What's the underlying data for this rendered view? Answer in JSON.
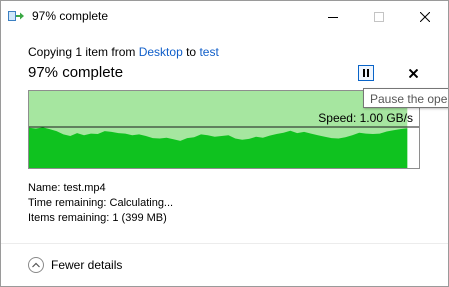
{
  "window": {
    "title": "97% complete"
  },
  "copy": {
    "prefix": "Copying 1 item from",
    "source": "Desktop",
    "mid": "to",
    "destination": "test",
    "status": "97% complete"
  },
  "controls": {
    "pause_tooltip": "Pause the operation"
  },
  "graph": {
    "speed_label": "Speed: 1.00 GB/s",
    "progress": 0.97,
    "fill_color": "#a6e6a0",
    "area_color": "#0fc21f",
    "line_color": "#1b1b1b",
    "speed_samples": [
      0.98,
      0.96,
      0.99,
      0.95,
      0.9,
      0.82,
      0.78,
      0.85,
      0.8,
      0.84,
      0.83,
      0.9,
      0.88,
      0.85,
      0.84,
      0.8,
      0.82,
      0.78,
      0.73,
      0.72,
      0.74,
      0.7,
      0.66,
      0.73,
      0.75,
      0.82,
      0.8,
      0.76,
      0.78,
      0.8,
      0.72,
      0.69,
      0.71,
      0.76,
      0.74,
      0.79,
      0.83,
      0.86,
      0.91,
      0.85,
      0.88,
      0.84,
      0.8,
      0.76,
      0.73,
      0.72,
      0.75,
      0.8,
      0.86,
      0.84,
      0.83,
      0.84,
      0.89,
      0.92,
      0.95,
      0.97
    ]
  },
  "details": {
    "name_label": "Name:",
    "name_value": "test.mp4",
    "time_label": "Time remaining:",
    "time_value": "Calculating...",
    "items_label": "Items remaining:",
    "items_value": "1 (399 MB)"
  },
  "footer": {
    "toggle_label": "Fewer details"
  }
}
